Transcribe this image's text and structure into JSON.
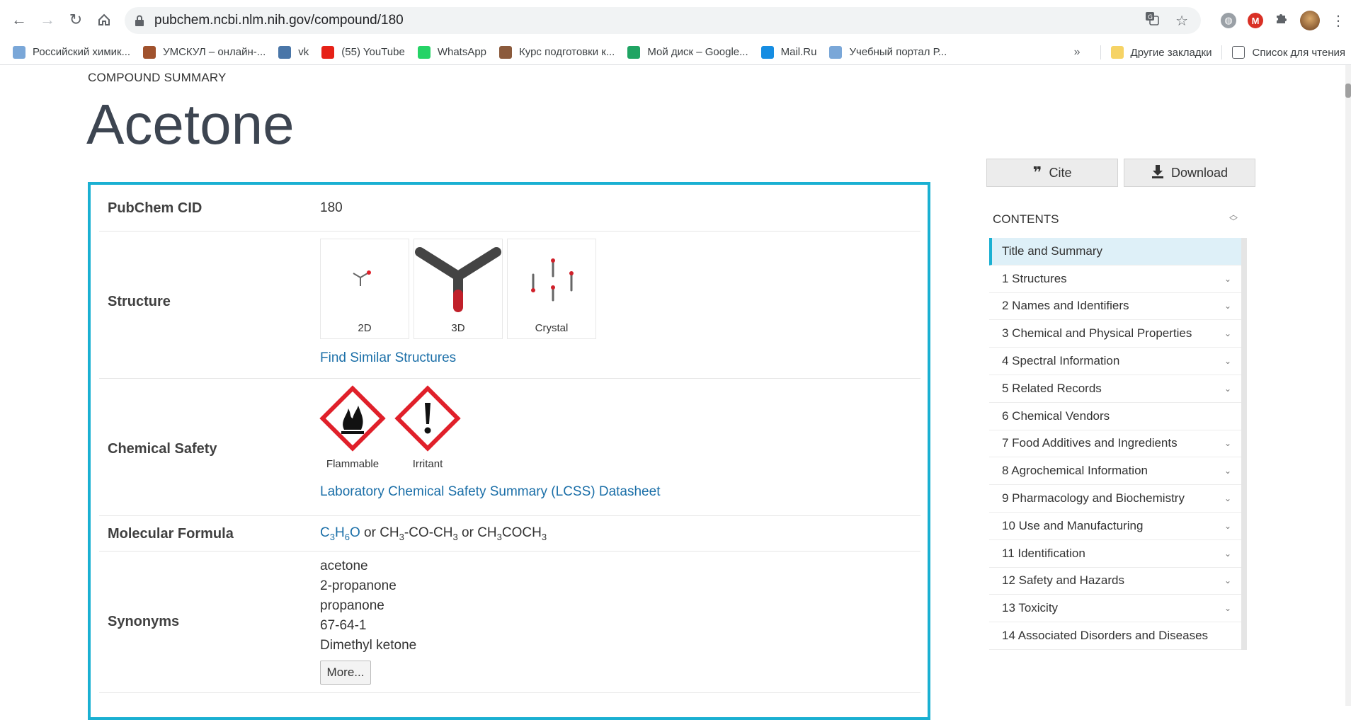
{
  "browser": {
    "url": "pubchem.ncbi.nlm.nih.gov/compound/180",
    "bookmarks": [
      {
        "label": "Российский химик...",
        "icon": "flask-icon",
        "color": "#7aa7d8"
      },
      {
        "label": "УМСКУЛ – онлайн-...",
        "icon": "fox-icon",
        "color": "#a0522d"
      },
      {
        "label": "vk",
        "icon": "vk-icon",
        "color": "#4a76a8"
      },
      {
        "label": "(55) YouTube",
        "icon": "youtube-icon",
        "color": "#e62117"
      },
      {
        "label": "WhatsApp",
        "icon": "whatsapp-icon",
        "color": "#25d366"
      },
      {
        "label": "Курс подготовки к...",
        "icon": "course-icon",
        "color": "#8b5a3c"
      },
      {
        "label": "Мой диск – Google...",
        "icon": "google-drive-icon",
        "color": "#1fa463"
      },
      {
        "label": "Mail.Ru",
        "icon": "mailru-icon",
        "color": "#168de2"
      },
      {
        "label": "Учебный портал Р...",
        "icon": "flask-icon",
        "color": "#7aa7d8"
      }
    ],
    "overflow": "»",
    "other_bookmarks": "Другие закладки",
    "reading_list": "Список для чтения"
  },
  "page": {
    "section_label": "COMPOUND SUMMARY",
    "title": "Acetone",
    "rows": {
      "cid": {
        "label": "PubChem CID",
        "value": "180"
      },
      "structure": {
        "label": "Structure",
        "thumbs": [
          "2D",
          "3D",
          "Crystal"
        ],
        "link": "Find Similar Structures"
      },
      "safety": {
        "label": "Chemical Safety",
        "pictograms": [
          "Flammable",
          "Irritant"
        ],
        "link": "Laboratory Chemical Safety Summary (LCSS) Datasheet"
      },
      "formula": {
        "label": "Molecular Formula",
        "link": "C3H6O",
        "or1": "or",
        "alt1": "CH3-CO-CH3",
        "or2": "or",
        "alt2": "CH3COCH3"
      },
      "synonyms": {
        "label": "Synonyms",
        "items": [
          "acetone",
          "2-propanone",
          "propanone",
          "67-64-1",
          "Dimethyl ketone"
        ],
        "more": "More..."
      }
    }
  },
  "sidebar": {
    "cite": "Cite",
    "download": "Download",
    "contents_label": "CONTENTS",
    "toc": [
      {
        "label": "Title and Summary",
        "active": true,
        "chev": false
      },
      {
        "label": "1 Structures",
        "chev": true
      },
      {
        "label": "2 Names and Identifiers",
        "chev": true
      },
      {
        "label": "3 Chemical and Physical Properties",
        "chev": true
      },
      {
        "label": "4 Spectral Information",
        "chev": true
      },
      {
        "label": "5 Related Records",
        "chev": true
      },
      {
        "label": "6 Chemical Vendors",
        "chev": false
      },
      {
        "label": "7 Food Additives and Ingredients",
        "chev": true
      },
      {
        "label": "8 Agrochemical Information",
        "chev": true
      },
      {
        "label": "9 Pharmacology and Biochemistry",
        "chev": true
      },
      {
        "label": "10 Use and Manufacturing",
        "chev": true
      },
      {
        "label": "11 Identification",
        "chev": true
      },
      {
        "label": "12 Safety and Hazards",
        "chev": true
      },
      {
        "label": "13 Toxicity",
        "chev": true
      },
      {
        "label": "14 Associated Disorders and Diseases",
        "chev": false
      }
    ]
  },
  "colors": {
    "accent": "#1ab0d2",
    "link": "#1b6fa8",
    "hazard": "#e0202a"
  }
}
